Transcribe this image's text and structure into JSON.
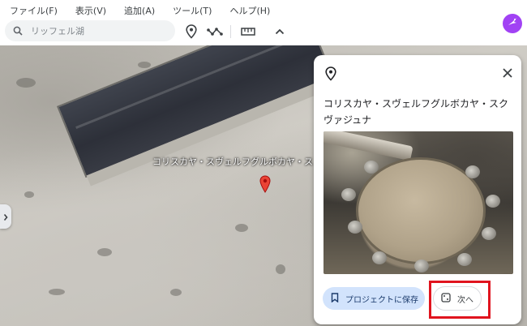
{
  "menu": {
    "items": [
      "ファイル(F)",
      "表示(V)",
      "追加(A)",
      "ツール(T)",
      "ヘルプ(H)"
    ]
  },
  "search": {
    "placeholder": "リッフェル湖"
  },
  "toolbar": {
    "icons": [
      "search-icon",
      "place-mark-icon",
      "path-icon",
      "ruler-icon",
      "chevron-up-icon"
    ],
    "avatar_icon": "hummingbird-icon",
    "avatar_color": "#a142f4"
  },
  "map": {
    "place_label": "コリスカヤ・スヴェルフグルボカヤ・ス"
  },
  "card": {
    "title": "コリスカヤ・スヴェルフグルボカヤ・スクヴァジュナ",
    "save_label": "プロジェクトに保存",
    "next_label": "次へ"
  },
  "colors": {
    "accent": "#1a73e8",
    "save_bg": "#d2e3fc",
    "highlight": "#e0141e",
    "pin": "#ea4335"
  }
}
